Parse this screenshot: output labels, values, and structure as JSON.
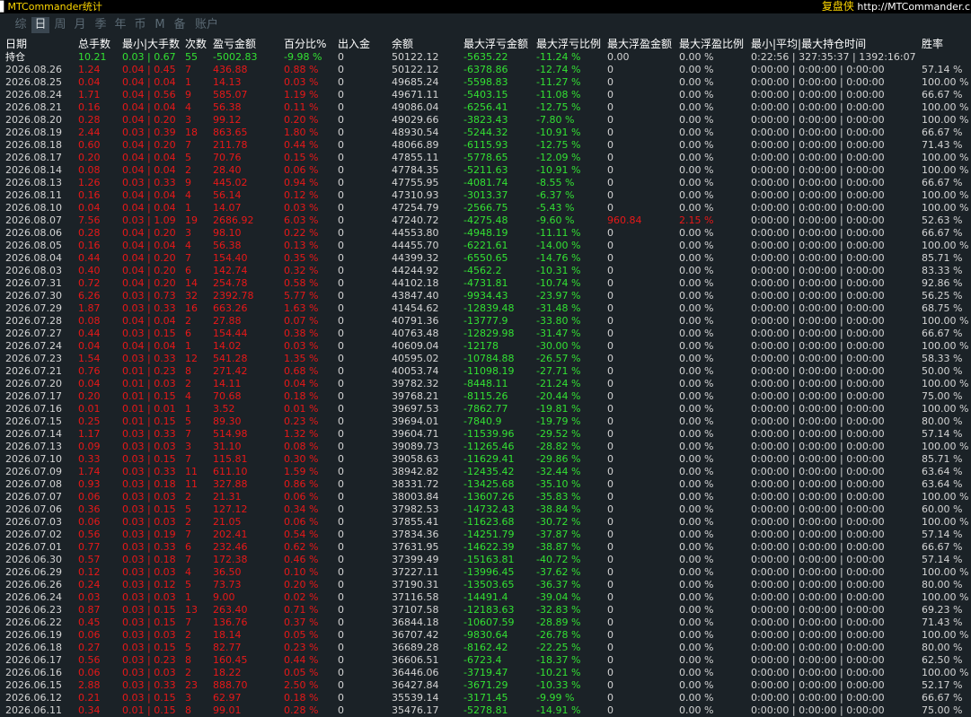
{
  "app": {
    "title": "MTCommander统计",
    "copy_label": "复盘侠",
    "url": "http://MTCommander.c"
  },
  "tabs": [
    {
      "label": "综",
      "active": false
    },
    {
      "label": "日",
      "active": true
    },
    {
      "label": "周",
      "active": false
    },
    {
      "label": "月",
      "active": false
    },
    {
      "label": "季",
      "active": false
    },
    {
      "label": "年",
      "active": false
    },
    {
      "label": "币",
      "active": false
    },
    {
      "label": "M",
      "active": false
    },
    {
      "label": "备",
      "active": false
    },
    {
      "label": "账户",
      "active": false
    }
  ],
  "table": {
    "headers": [
      "日期",
      "总手数",
      "最小|大手数",
      "次数",
      "盈亏金额",
      "百分比%",
      "出入金",
      "余额",
      "最大浮亏金额",
      "最大浮亏比例",
      "最大浮盈金额",
      "最大浮盈比例",
      "最小|平均|最大持仓时间",
      "胜率"
    ],
    "total": [
      "持仓",
      "10.21",
      "0.03 | 0.67",
      "55",
      "-5002.83",
      "-9.98 %",
      "0",
      "50122.12",
      "-5635.22",
      "-11.24 %",
      "0.00",
      "0.00 %",
      "0:22:56 | 327:35:37 | 1392:16:07",
      ""
    ],
    "rows": [
      [
        "2026.08.26",
        "1.24",
        "0.04 | 0.45",
        "7",
        "436.88",
        "0.88 %",
        "0",
        "50122.12",
        "-6378.86",
        "-12.74 %",
        "0",
        "0.00 %",
        "0:00:00 | 0:00:00 | 0:00:00",
        "57.14 %"
      ],
      [
        "2026.08.25",
        "0.04",
        "0.04 | 0.04",
        "1",
        "14.13",
        "0.03 %",
        "0",
        "49685.24",
        "-5598.83",
        "-11.27 %",
        "0",
        "0.00 %",
        "0:00:00 | 0:00:00 | 0:00:00",
        "100.00 %"
      ],
      [
        "2026.08.24",
        "1.71",
        "0.04 | 0.56",
        "9",
        "585.07",
        "1.19 %",
        "0",
        "49671.11",
        "-5403.15",
        "-11.08 %",
        "0",
        "0.00 %",
        "0:00:00 | 0:00:00 | 0:00:00",
        "66.67 %"
      ],
      [
        "2026.08.21",
        "0.16",
        "0.04 | 0.04",
        "4",
        "56.38",
        "0.11 %",
        "0",
        "49086.04",
        "-6256.41",
        "-12.75 %",
        "0",
        "0.00 %",
        "0:00:00 | 0:00:00 | 0:00:00",
        "100.00 %"
      ],
      [
        "2026.08.20",
        "0.28",
        "0.04 | 0.20",
        "3",
        "99.12",
        "0.20 %",
        "0",
        "49029.66",
        "-3823.43",
        "-7.80 %",
        "0",
        "0.00 %",
        "0:00:00 | 0:00:00 | 0:00:00",
        "100.00 %"
      ],
      [
        "2026.08.19",
        "2.44",
        "0.03 | 0.39",
        "18",
        "863.65",
        "1.80 %",
        "0",
        "48930.54",
        "-5244.32",
        "-10.91 %",
        "0",
        "0.00 %",
        "0:00:00 | 0:00:00 | 0:00:00",
        "66.67 %"
      ],
      [
        "2026.08.18",
        "0.60",
        "0.04 | 0.20",
        "7",
        "211.78",
        "0.44 %",
        "0",
        "48066.89",
        "-6115.93",
        "-12.75 %",
        "0",
        "0.00 %",
        "0:00:00 | 0:00:00 | 0:00:00",
        "71.43 %"
      ],
      [
        "2026.08.17",
        "0.20",
        "0.04 | 0.04",
        "5",
        "70.76",
        "0.15 %",
        "0",
        "47855.11",
        "-5778.65",
        "-12.09 %",
        "0",
        "0.00 %",
        "0:00:00 | 0:00:00 | 0:00:00",
        "100.00 %"
      ],
      [
        "2026.08.14",
        "0.08",
        "0.04 | 0.04",
        "2",
        "28.40",
        "0.06 %",
        "0",
        "47784.35",
        "-5211.63",
        "-10.91 %",
        "0",
        "0.00 %",
        "0:00:00 | 0:00:00 | 0:00:00",
        "100.00 %"
      ],
      [
        "2026.08.13",
        "1.26",
        "0.03 | 0.33",
        "9",
        "445.02",
        "0.94 %",
        "0",
        "47755.95",
        "-4081.74",
        "-8.55 %",
        "0",
        "0.00 %",
        "0:00:00 | 0:00:00 | 0:00:00",
        "66.67 %"
      ],
      [
        "2026.08.11",
        "0.16",
        "0.04 | 0.04",
        "4",
        "56.14",
        "0.12 %",
        "0",
        "47310.93",
        "-3013.37",
        "-6.37 %",
        "0",
        "0.00 %",
        "0:00:00 | 0:00:00 | 0:00:00",
        "100.00 %"
      ],
      [
        "2026.08.10",
        "0.04",
        "0.04 | 0.04",
        "1",
        "14.07",
        "0.03 %",
        "0",
        "47254.79",
        "-2566.75",
        "-5.43 %",
        "0",
        "0.00 %",
        "0:00:00 | 0:00:00 | 0:00:00",
        "100.00 %"
      ],
      [
        "2026.08.07",
        "7.56",
        "0.03 | 1.09",
        "19",
        "2686.92",
        "6.03 %",
        "0",
        "47240.72",
        "-4275.48",
        "-9.60 %",
        "960.84",
        "2.15 %",
        "0:00:00 | 0:00:00 | 0:00:00",
        "52.63 %"
      ],
      [
        "2026.08.06",
        "0.28",
        "0.04 | 0.20",
        "3",
        "98.10",
        "0.22 %",
        "0",
        "44553.80",
        "-4948.19",
        "-11.11 %",
        "0",
        "0.00 %",
        "0:00:00 | 0:00:00 | 0:00:00",
        "66.67 %"
      ],
      [
        "2026.08.05",
        "0.16",
        "0.04 | 0.04",
        "4",
        "56.38",
        "0.13 %",
        "0",
        "44455.70",
        "-6221.61",
        "-14.00 %",
        "0",
        "0.00 %",
        "0:00:00 | 0:00:00 | 0:00:00",
        "100.00 %"
      ],
      [
        "2026.08.04",
        "0.44",
        "0.04 | 0.20",
        "7",
        "154.40",
        "0.35 %",
        "0",
        "44399.32",
        "-6550.65",
        "-14.76 %",
        "0",
        "0.00 %",
        "0:00:00 | 0:00:00 | 0:00:00",
        "85.71 %"
      ],
      [
        "2026.08.03",
        "0.40",
        "0.04 | 0.20",
        "6",
        "142.74",
        "0.32 %",
        "0",
        "44244.92",
        "-4562.2",
        "-10.31 %",
        "0",
        "0.00 %",
        "0:00:00 | 0:00:00 | 0:00:00",
        "83.33 %"
      ],
      [
        "2026.07.31",
        "0.72",
        "0.04 | 0.20",
        "14",
        "254.78",
        "0.58 %",
        "0",
        "44102.18",
        "-4731.81",
        "-10.74 %",
        "0",
        "0.00 %",
        "0:00:00 | 0:00:00 | 0:00:00",
        "92.86 %"
      ],
      [
        "2026.07.30",
        "6.26",
        "0.03 | 0.73",
        "32",
        "2392.78",
        "5.77 %",
        "0",
        "43847.40",
        "-9934.43",
        "-23.97 %",
        "0",
        "0.00 %",
        "0:00:00 | 0:00:00 | 0:00:00",
        "56.25 %"
      ],
      [
        "2026.07.29",
        "1.87",
        "0.03 | 0.33",
        "16",
        "663.26",
        "1.63 %",
        "0",
        "41454.62",
        "-12839.48",
        "-31.48 %",
        "0",
        "0.00 %",
        "0:00:00 | 0:00:00 | 0:00:00",
        "68.75 %"
      ],
      [
        "2026.07.28",
        "0.08",
        "0.04 | 0.04",
        "2",
        "27.88",
        "0.07 %",
        "0",
        "40791.36",
        "-13777.9",
        "-33.80 %",
        "0",
        "0.00 %",
        "0:00:00 | 0:00:00 | 0:00:00",
        "100.00 %"
      ],
      [
        "2026.07.27",
        "0.44",
        "0.03 | 0.15",
        "6",
        "154.44",
        "0.38 %",
        "0",
        "40763.48",
        "-12829.98",
        "-31.47 %",
        "0",
        "0.00 %",
        "0:00:00 | 0:00:00 | 0:00:00",
        "66.67 %"
      ],
      [
        "2026.07.24",
        "0.04",
        "0.04 | 0.04",
        "1",
        "14.02",
        "0.03 %",
        "0",
        "40609.04",
        "-12178",
        "-30.00 %",
        "0",
        "0.00 %",
        "0:00:00 | 0:00:00 | 0:00:00",
        "100.00 %"
      ],
      [
        "2026.07.23",
        "1.54",
        "0.03 | 0.33",
        "12",
        "541.28",
        "1.35 %",
        "0",
        "40595.02",
        "-10784.88",
        "-26.57 %",
        "0",
        "0.00 %",
        "0:00:00 | 0:00:00 | 0:00:00",
        "58.33 %"
      ],
      [
        "2026.07.21",
        "0.76",
        "0.01 | 0.23",
        "8",
        "271.42",
        "0.68 %",
        "0",
        "40053.74",
        "-11098.19",
        "-27.71 %",
        "0",
        "0.00 %",
        "0:00:00 | 0:00:00 | 0:00:00",
        "50.00 %"
      ],
      [
        "2026.07.20",
        "0.04",
        "0.01 | 0.03",
        "2",
        "14.11",
        "0.04 %",
        "0",
        "39782.32",
        "-8448.11",
        "-21.24 %",
        "0",
        "0.00 %",
        "0:00:00 | 0:00:00 | 0:00:00",
        "100.00 %"
      ],
      [
        "2026.07.17",
        "0.20",
        "0.01 | 0.15",
        "4",
        "70.68",
        "0.18 %",
        "0",
        "39768.21",
        "-8115.26",
        "-20.44 %",
        "0",
        "0.00 %",
        "0:00:00 | 0:00:00 | 0:00:00",
        "75.00 %"
      ],
      [
        "2026.07.16",
        "0.01",
        "0.01 | 0.01",
        "1",
        "3.52",
        "0.01 %",
        "0",
        "39697.53",
        "-7862.77",
        "-19.81 %",
        "0",
        "0.00 %",
        "0:00:00 | 0:00:00 | 0:00:00",
        "100.00 %"
      ],
      [
        "2026.07.15",
        "0.25",
        "0.01 | 0.15",
        "5",
        "89.30",
        "0.23 %",
        "0",
        "39694.01",
        "-7840.9",
        "-19.79 %",
        "0",
        "0.00 %",
        "0:00:00 | 0:00:00 | 0:00:00",
        "80.00 %"
      ],
      [
        "2026.07.14",
        "1.17",
        "0.03 | 0.33",
        "7",
        "514.98",
        "1.32 %",
        "0",
        "39604.71",
        "-11539.96",
        "-29.52 %",
        "0",
        "0.00 %",
        "0:00:00 | 0:00:00 | 0:00:00",
        "57.14 %"
      ],
      [
        "2026.07.13",
        "0.09",
        "0.03 | 0.03",
        "3",
        "31.10",
        "0.08 %",
        "0",
        "39089.73",
        "-11265.46",
        "-28.82 %",
        "0",
        "0.00 %",
        "0:00:00 | 0:00:00 | 0:00:00",
        "100.00 %"
      ],
      [
        "2026.07.10",
        "0.33",
        "0.03 | 0.15",
        "7",
        "115.81",
        "0.30 %",
        "0",
        "39058.63",
        "-11629.41",
        "-29.86 %",
        "0",
        "0.00 %",
        "0:00:00 | 0:00:00 | 0:00:00",
        "85.71 %"
      ],
      [
        "2026.07.09",
        "1.74",
        "0.03 | 0.33",
        "11",
        "611.10",
        "1.59 %",
        "0",
        "38942.82",
        "-12435.42",
        "-32.44 %",
        "0",
        "0.00 %",
        "0:00:00 | 0:00:00 | 0:00:00",
        "63.64 %"
      ],
      [
        "2026.07.08",
        "0.93",
        "0.03 | 0.18",
        "11",
        "327.88",
        "0.86 %",
        "0",
        "38331.72",
        "-13425.68",
        "-35.10 %",
        "0",
        "0.00 %",
        "0:00:00 | 0:00:00 | 0:00:00",
        "63.64 %"
      ],
      [
        "2026.07.07",
        "0.06",
        "0.03 | 0.03",
        "2",
        "21.31",
        "0.06 %",
        "0",
        "38003.84",
        "-13607.26",
        "-35.83 %",
        "0",
        "0.00 %",
        "0:00:00 | 0:00:00 | 0:00:00",
        "100.00 %"
      ],
      [
        "2026.07.06",
        "0.36",
        "0.03 | 0.15",
        "5",
        "127.12",
        "0.34 %",
        "0",
        "37982.53",
        "-14732.43",
        "-38.84 %",
        "0",
        "0.00 %",
        "0:00:00 | 0:00:00 | 0:00:00",
        "60.00 %"
      ],
      [
        "2026.07.03",
        "0.06",
        "0.03 | 0.03",
        "2",
        "21.05",
        "0.06 %",
        "0",
        "37855.41",
        "-11623.68",
        "-30.72 %",
        "0",
        "0.00 %",
        "0:00:00 | 0:00:00 | 0:00:00",
        "100.00 %"
      ],
      [
        "2026.07.02",
        "0.56",
        "0.03 | 0.19",
        "7",
        "202.41",
        "0.54 %",
        "0",
        "37834.36",
        "-14251.79",
        "-37.87 %",
        "0",
        "0.00 %",
        "0:00:00 | 0:00:00 | 0:00:00",
        "57.14 %"
      ],
      [
        "2026.07.01",
        "0.77",
        "0.03 | 0.33",
        "6",
        "232.46",
        "0.62 %",
        "0",
        "37631.95",
        "-14622.39",
        "-38.87 %",
        "0",
        "0.00 %",
        "0:00:00 | 0:00:00 | 0:00:00",
        "66.67 %"
      ],
      [
        "2026.06.30",
        "0.57",
        "0.03 | 0.18",
        "7",
        "172.38",
        "0.46 %",
        "0",
        "37399.49",
        "-15163.81",
        "-40.72 %",
        "0",
        "0.00 %",
        "0:00:00 | 0:00:00 | 0:00:00",
        "57.14 %"
      ],
      [
        "2026.06.29",
        "0.12",
        "0.03 | 0.03",
        "4",
        "36.50",
        "0.10 %",
        "0",
        "37227.11",
        "-13996.45",
        "-37.62 %",
        "0",
        "0.00 %",
        "0:00:00 | 0:00:00 | 0:00:00",
        "100.00 %"
      ],
      [
        "2026.06.26",
        "0.24",
        "0.03 | 0.12",
        "5",
        "73.73",
        "0.20 %",
        "0",
        "37190.31",
        "-13503.65",
        "-36.37 %",
        "0",
        "0.00 %",
        "0:00:00 | 0:00:00 | 0:00:00",
        "80.00 %"
      ],
      [
        "2026.06.24",
        "0.03",
        "0.03 | 0.03",
        "1",
        "9.00",
        "0.02 %",
        "0",
        "37116.58",
        "-14491.4",
        "-39.04 %",
        "0",
        "0.00 %",
        "0:00:00 | 0:00:00 | 0:00:00",
        "100.00 %"
      ],
      [
        "2026.06.23",
        "0.87",
        "0.03 | 0.15",
        "13",
        "263.40",
        "0.71 %",
        "0",
        "37107.58",
        "-12183.63",
        "-32.83 %",
        "0",
        "0.00 %",
        "0:00:00 | 0:00:00 | 0:00:00",
        "69.23 %"
      ],
      [
        "2026.06.22",
        "0.45",
        "0.03 | 0.15",
        "7",
        "136.76",
        "0.37 %",
        "0",
        "36844.18",
        "-10607.59",
        "-28.89 %",
        "0",
        "0.00 %",
        "0:00:00 | 0:00:00 | 0:00:00",
        "71.43 %"
      ],
      [
        "2026.06.19",
        "0.06",
        "0.03 | 0.03",
        "2",
        "18.14",
        "0.05 %",
        "0",
        "36707.42",
        "-9830.64",
        "-26.78 %",
        "0",
        "0.00 %",
        "0:00:00 | 0:00:00 | 0:00:00",
        "100.00 %"
      ],
      [
        "2026.06.18",
        "0.27",
        "0.03 | 0.15",
        "5",
        "82.77",
        "0.23 %",
        "0",
        "36689.28",
        "-8162.42",
        "-22.25 %",
        "0",
        "0.00 %",
        "0:00:00 | 0:00:00 | 0:00:00",
        "80.00 %"
      ],
      [
        "2026.06.17",
        "0.56",
        "0.03 | 0.23",
        "8",
        "160.45",
        "0.44 %",
        "0",
        "36606.51",
        "-6723.4",
        "-18.37 %",
        "0",
        "0.00 %",
        "0:00:00 | 0:00:00 | 0:00:00",
        "62.50 %"
      ],
      [
        "2026.06.16",
        "0.06",
        "0.03 | 0.03",
        "2",
        "18.22",
        "0.05 %",
        "0",
        "36446.06",
        "-3719.47",
        "-10.21 %",
        "0",
        "0.00 %",
        "0:00:00 | 0:00:00 | 0:00:00",
        "100.00 %"
      ],
      [
        "2026.06.15",
        "2.88",
        "0.03 | 0.33",
        "23",
        "888.70",
        "2.50 %",
        "0",
        "36427.84",
        "-3671.29",
        "-10.33 %",
        "0",
        "0.00 %",
        "0:00:00 | 0:00:00 | 0:00:00",
        "52.17 %"
      ],
      [
        "2026.06.12",
        "0.21",
        "0.03 | 0.15",
        "3",
        "62.97",
        "0.18 %",
        "0",
        "35539.14",
        "-3171.45",
        "-9.99 %",
        "0",
        "0.00 %",
        "0:00:00 | 0:00:00 | 0:00:00",
        "66.67 %"
      ],
      [
        "2026.06.11",
        "0.34",
        "0.01 | 0.15",
        "8",
        "99.01",
        "0.28 %",
        "0",
        "35476.17",
        "-5278.81",
        "-14.91 %",
        "0",
        "0.00 %",
        "0:00:00 | 0:00:00 | 0:00:00",
        "75.00 %"
      ]
    ]
  },
  "colors": {
    "accent_yellow": "#ffd800",
    "loss_red": "#e81818",
    "float_green": "#33e033",
    "panel_bg": "#1b2227",
    "active_tab_bg": "#3a4650"
  }
}
